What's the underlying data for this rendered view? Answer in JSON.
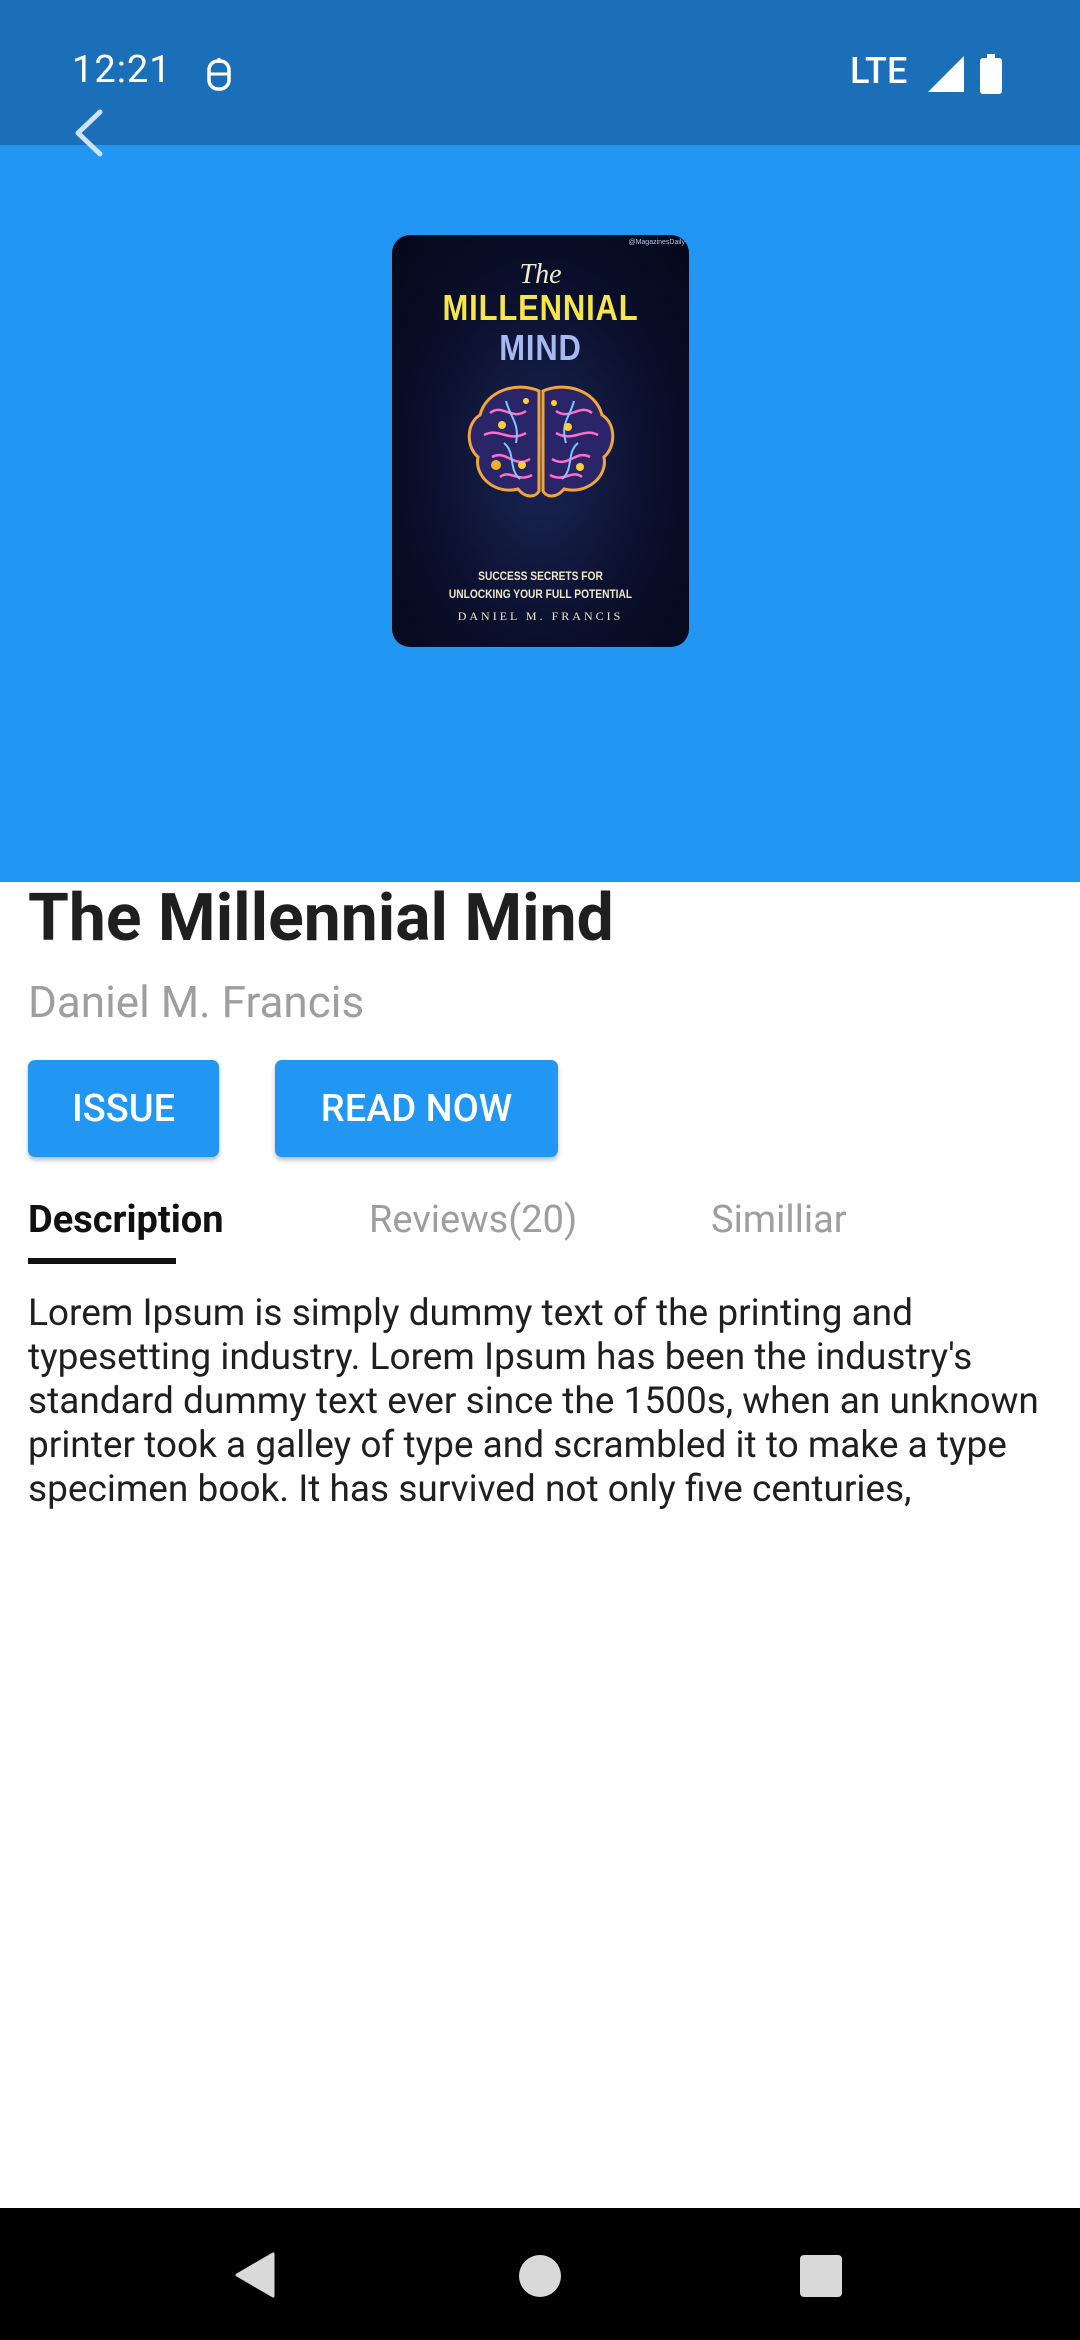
{
  "status_bar": {
    "time": "12:21",
    "network": "LTE",
    "icons": [
      "notification-icon",
      "signal-icon",
      "battery-icon"
    ]
  },
  "header": {
    "back_icon": "back-arrow-icon",
    "background_color": "#2196f3"
  },
  "cover": {
    "corner_text": "@MagazinesDaily",
    "the": "The",
    "title_line1": "MILLENNIAL",
    "title_line2": "MIND",
    "subtitle_line1": "SUCCESS SECRETS FOR",
    "subtitle_line2": "UNLOCKING YOUR FULL POTENTIAL",
    "author": "DANIEL M. FRANCIS"
  },
  "book": {
    "title": "The Millennial Mind",
    "author": "Daniel M. Francis"
  },
  "actions": {
    "issue_label": "ISSUE",
    "read_now_label": "READ NOW"
  },
  "tabs": [
    {
      "label": "Description",
      "selected": true
    },
    {
      "label": "Reviews(20)",
      "selected": false
    },
    {
      "label": "Similliar",
      "selected": false
    }
  ],
  "description": "Lorem Ipsum is simply dummy text of the printing and typesetting industry. Lorem Ipsum has been the industry's standard dummy text ever since the 1500s, when an unknown printer took a galley of type and scrambled it to make a type specimen book. It has survived not only five centuries,",
  "nav_bar": {
    "icons": [
      "nav-back-icon",
      "nav-home-icon",
      "nav-recents-icon"
    ]
  },
  "colors": {
    "status_bar": "#1b6fb8",
    "primary": "#2196f3",
    "title_text": "#1f1f1f",
    "secondary_text": "#9e9e9e"
  }
}
